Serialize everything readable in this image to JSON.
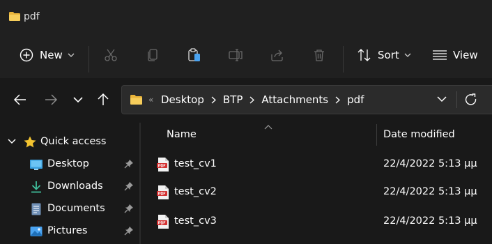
{
  "window": {
    "title": "pdf"
  },
  "toolbar": {
    "new_label": "New",
    "sort_label": "Sort",
    "view_label": "View",
    "icons": [
      "plus-circle-icon",
      "cut-icon",
      "copy-icon",
      "paste-icon",
      "rename-icon",
      "share-icon",
      "delete-icon",
      "sort-icon",
      "view-icon"
    ]
  },
  "address": {
    "overflow_glyph": "«",
    "crumbs": [
      "Desktop",
      "BTP",
      "Attachments",
      "pdf"
    ]
  },
  "sidebar": {
    "items": [
      {
        "label": "Quick access",
        "icon": "star-icon"
      },
      {
        "label": "Desktop",
        "icon": "desktop-icon",
        "pinned": true
      },
      {
        "label": "Downloads",
        "icon": "download-icon",
        "pinned": true
      },
      {
        "label": "Documents",
        "icon": "document-icon",
        "pinned": true
      },
      {
        "label": "Pictures",
        "icon": "pictures-icon",
        "pinned": true
      }
    ]
  },
  "filelist": {
    "columns": {
      "name": "Name",
      "date": "Date modified"
    },
    "rows": [
      {
        "name": "test_cv1",
        "date": "22/4/2022 5:13 μμ"
      },
      {
        "name": "test_cv2",
        "date": "22/4/2022 5:13 μμ"
      },
      {
        "name": "test_cv3",
        "date": "22/4/2022 5:13 μμ"
      }
    ]
  },
  "colors": {
    "background": "#191919",
    "toolbar": "#202020",
    "addressbar": "#2b2b2b",
    "folder": "#f3c24c",
    "pdf": "#d32f2f",
    "accent_blue": "#4aa3f0"
  }
}
